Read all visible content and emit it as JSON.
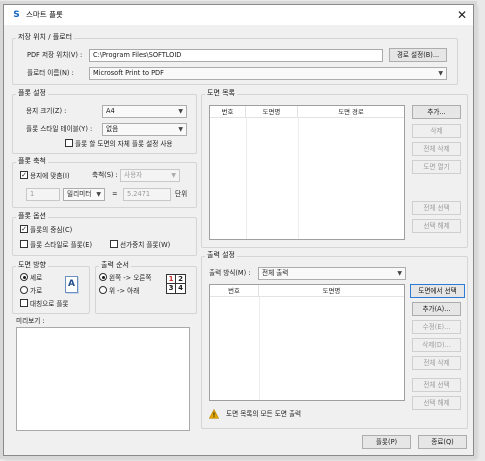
{
  "window": {
    "title": "스마트 플롯",
    "app_icon": "smart-plot-logo",
    "close_glyph": "✕"
  },
  "save": {
    "legend": "저장 위치 / 플로터",
    "pdf_path_label": "PDF 저장 위치(V) :",
    "pdf_path_value": "C:\\Program Files\\SOFTLOID",
    "path_button": "경로 설정(B)...",
    "plotter_label": "플로터 이름(N) :",
    "plotter_value": "Microsoft Print to PDF"
  },
  "plot_settings": {
    "legend": "플롯 설정",
    "paper_size_label": "용지 크기(Z) :",
    "paper_size_value": "A4",
    "style_table_label": "플롯 스타일 테이블(Y) :",
    "style_table_value": "없음",
    "own_settings_label": "플롯 할 도면의 자체 플롯 설정 사용",
    "own_settings_checked": false
  },
  "plot_scale": {
    "legend": "플롯 축척",
    "fit_label": "용지에 맞춤(I)",
    "fit_checked": true,
    "scale_label": "축척(S) :",
    "scale_value": "사용자",
    "value1": "1",
    "unit_value": "밀리미터",
    "equals": "=",
    "value2": "5.2471",
    "unit_label": "단위"
  },
  "plot_options": {
    "legend": "플롯 옵션",
    "center_label": "플롯의 중심(C)",
    "center_checked": true,
    "style_label": "플롯 스타일로 플롯(E)",
    "style_checked": false,
    "lineweight_label": "선가중치 플롯(W)",
    "lineweight_checked": false
  },
  "orientation": {
    "legend": "도면 방향",
    "portrait": "세로",
    "landscape": "가로",
    "upside_down": "대칭으로 플롯",
    "selected": "portrait",
    "preview_letter": "A"
  },
  "output_order": {
    "legend": "출력 순서",
    "left_to_right": "왼쪽 -> 오른쪽",
    "top_to_bottom": "위 -> 아래",
    "selected": "left_to_right",
    "grid": [
      "1",
      "2",
      "3",
      "4"
    ],
    "grid_color": "#c62828"
  },
  "preview": {
    "label": "미리보기 :"
  },
  "drawing_list": {
    "legend": "도면 목록",
    "columns": [
      "번호",
      "도면명",
      "도면 경로"
    ],
    "buttons": [
      "추가...",
      "삭제",
      "전체 삭제",
      "도면 열기",
      "전체 선택",
      "선택 해제"
    ],
    "enabled": [
      true,
      false,
      false,
      false,
      false,
      false
    ]
  },
  "output_settings": {
    "legend": "출력 설정",
    "method_label": "출력 방식(M) :",
    "method_value": "전체 출력",
    "columns": [
      "번호",
      "도면명"
    ],
    "buttons": [
      "도면에서 선택",
      "추가(A)...",
      "수정(E)...",
      "삭제(D)...",
      "전체 삭제",
      "전체 선택",
      "선택 해제"
    ],
    "enabled": [
      true,
      true,
      false,
      false,
      false,
      false,
      false
    ],
    "warning_text": "도면 목록의 모든 도면 출력",
    "warning_icon": "warning-icon",
    "warning_color": "#e6a800"
  },
  "footer": {
    "plot_button": "플롯(P)",
    "close_button": "종료(Q)"
  },
  "colors": {
    "accent": "#2a7cd6",
    "window_bg": "#f0f0f0"
  }
}
